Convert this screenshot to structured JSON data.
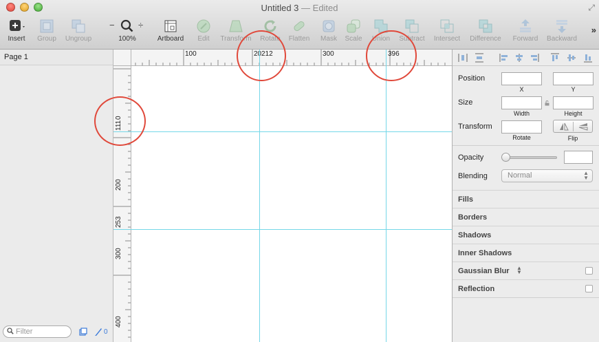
{
  "window": {
    "title": "Untitled 3",
    "status": "— Edited"
  },
  "toolbar": {
    "items": [
      {
        "label": "Insert",
        "icon": "insert-icon",
        "enabled": true
      },
      {
        "label": "Group",
        "icon": "group-icon",
        "enabled": false
      },
      {
        "label": "Ungroup",
        "icon": "ungroup-icon",
        "enabled": false
      },
      {
        "label": "100%",
        "icon": "zoom-icon",
        "enabled": true
      },
      {
        "label": "Artboard",
        "icon": "artboard-icon",
        "enabled": true
      },
      {
        "label": "Edit",
        "icon": "edit-icon",
        "enabled": false
      },
      {
        "label": "Transform",
        "icon": "transform-icon",
        "enabled": false
      },
      {
        "label": "Rotate",
        "icon": "rotate-icon",
        "enabled": false
      },
      {
        "label": "Flatten",
        "icon": "flatten-icon",
        "enabled": false
      },
      {
        "label": "Mask",
        "icon": "mask-icon",
        "enabled": false
      },
      {
        "label": "Scale",
        "icon": "scale-icon",
        "enabled": false
      },
      {
        "label": "Union",
        "icon": "union-icon",
        "enabled": false
      },
      {
        "label": "Subtract",
        "icon": "subtract-icon",
        "enabled": false
      },
      {
        "label": "Intersect",
        "icon": "intersect-icon",
        "enabled": false
      },
      {
        "label": "Difference",
        "icon": "difference-icon",
        "enabled": false
      },
      {
        "label": "Forward",
        "icon": "forward-icon",
        "enabled": false
      },
      {
        "label": "Backward",
        "icon": "backward-icon",
        "enabled": false
      }
    ],
    "zoom_minus": "−",
    "zoom_plus": "÷",
    "more": "»"
  },
  "pages": {
    "items": [
      "Page 1"
    ],
    "filter_placeholder": "Filter",
    "slice_count": "0"
  },
  "rulers": {
    "top_labels": [
      "100",
      "20",
      "212",
      "300",
      "396"
    ],
    "left_labels": [
      "0",
      "111",
      "200",
      "253",
      "300",
      "400"
    ]
  },
  "guides": {
    "vertical": [
      212,
      396
    ],
    "horizontal": [
      111,
      253
    ]
  },
  "colors": {
    "guide": "#74d7e8",
    "highlight_circle": "#e0483a"
  },
  "inspector": {
    "position_label": "Position",
    "x_label": "X",
    "y_label": "Y",
    "size_label": "Size",
    "width_label": "Width",
    "height_label": "Height",
    "transform_label": "Transform",
    "rotate_label": "Rotate",
    "flip_label": "Flip",
    "opacity_label": "Opacity",
    "blending_label": "Blending",
    "blending_value": "Normal",
    "sections": [
      "Fills",
      "Borders",
      "Shadows",
      "Inner Shadows",
      "Gaussian Blur",
      "Reflection"
    ]
  }
}
